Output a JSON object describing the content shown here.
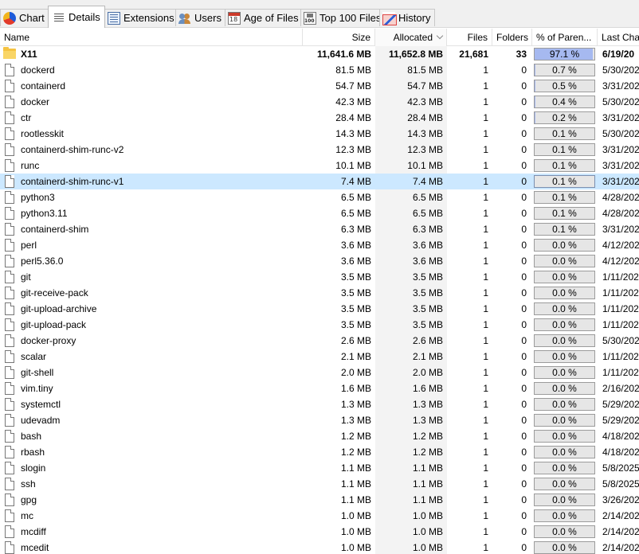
{
  "tabs": [
    {
      "label": "Chart",
      "icon": "chart-icon"
    },
    {
      "label": "Details",
      "icon": "details-icon",
      "active": true
    },
    {
      "label": "Extensions",
      "icon": "extensions-icon"
    },
    {
      "label": "Users",
      "icon": "users-icon"
    },
    {
      "label": "Age of Files",
      "icon": "calendar-icon"
    },
    {
      "label": "Top 100 Files",
      "icon": "top100-icon"
    },
    {
      "label": "History",
      "icon": "history-icon"
    }
  ],
  "columns": {
    "name": "Name",
    "size": "Size",
    "allocated": "Allocated",
    "files": "Files",
    "folders": "Folders",
    "percent": "% of Paren...",
    "last_change": "Last Char"
  },
  "rows": [
    {
      "name": "X11",
      "type": "folder",
      "size": "11,641.6 MB",
      "allocated": "11,652.8 MB",
      "files": "21,681",
      "folders": "33",
      "percent": "97.1 %",
      "percent_value": 97.1,
      "date": "6/19/20"
    },
    {
      "name": "dockerd",
      "type": "file",
      "size": "81.5 MB",
      "allocated": "81.5 MB",
      "files": "1",
      "folders": "0",
      "percent": "0.7 %",
      "percent_value": 0.7,
      "date": "5/30/202"
    },
    {
      "name": "containerd",
      "type": "file",
      "size": "54.7 MB",
      "allocated": "54.7 MB",
      "files": "1",
      "folders": "0",
      "percent": "0.5 %",
      "percent_value": 0.5,
      "date": "3/31/202"
    },
    {
      "name": "docker",
      "type": "file",
      "size": "42.3 MB",
      "allocated": "42.3 MB",
      "files": "1",
      "folders": "0",
      "percent": "0.4 %",
      "percent_value": 0.4,
      "date": "5/30/202"
    },
    {
      "name": "ctr",
      "type": "file",
      "size": "28.4 MB",
      "allocated": "28.4 MB",
      "files": "1",
      "folders": "0",
      "percent": "0.2 %",
      "percent_value": 0.2,
      "date": "3/31/202"
    },
    {
      "name": "rootlesskit",
      "type": "file",
      "size": "14.3 MB",
      "allocated": "14.3 MB",
      "files": "1",
      "folders": "0",
      "percent": "0.1 %",
      "percent_value": 0.1,
      "date": "5/30/202"
    },
    {
      "name": "containerd-shim-runc-v2",
      "type": "file",
      "size": "12.3 MB",
      "allocated": "12.3 MB",
      "files": "1",
      "folders": "0",
      "percent": "0.1 %",
      "percent_value": 0.1,
      "date": "3/31/202"
    },
    {
      "name": "runc",
      "type": "file",
      "size": "10.1 MB",
      "allocated": "10.1 MB",
      "files": "1",
      "folders": "0",
      "percent": "0.1 %",
      "percent_value": 0.1,
      "date": "3/31/202"
    },
    {
      "name": "containerd-shim-runc-v1",
      "type": "file",
      "size": "7.4 MB",
      "allocated": "7.4 MB",
      "files": "1",
      "folders": "0",
      "percent": "0.1 %",
      "percent_value": 0.1,
      "date": "3/31/202",
      "selected": true
    },
    {
      "name": "python3",
      "type": "file",
      "size": "6.5 MB",
      "allocated": "6.5 MB",
      "files": "1",
      "folders": "0",
      "percent": "0.1 %",
      "percent_value": 0.1,
      "date": "4/28/202"
    },
    {
      "name": "python3.11",
      "type": "file",
      "size": "6.5 MB",
      "allocated": "6.5 MB",
      "files": "1",
      "folders": "0",
      "percent": "0.1 %",
      "percent_value": 0.1,
      "date": "4/28/202"
    },
    {
      "name": "containerd-shim",
      "type": "file",
      "size": "6.3 MB",
      "allocated": "6.3 MB",
      "files": "1",
      "folders": "0",
      "percent": "0.1 %",
      "percent_value": 0.1,
      "date": "3/31/202"
    },
    {
      "name": "perl",
      "type": "file",
      "size": "3.6 MB",
      "allocated": "3.6 MB",
      "files": "1",
      "folders": "0",
      "percent": "0.0 %",
      "percent_value": 0.0,
      "date": "4/12/202"
    },
    {
      "name": "perl5.36.0",
      "type": "file",
      "size": "3.6 MB",
      "allocated": "3.6 MB",
      "files": "1",
      "folders": "0",
      "percent": "0.0 %",
      "percent_value": 0.0,
      "date": "4/12/202"
    },
    {
      "name": "git",
      "type": "file",
      "size": "3.5 MB",
      "allocated": "3.5 MB",
      "files": "1",
      "folders": "0",
      "percent": "0.0 %",
      "percent_value": 0.0,
      "date": "1/11/202"
    },
    {
      "name": "git-receive-pack",
      "type": "file",
      "size": "3.5 MB",
      "allocated": "3.5 MB",
      "files": "1",
      "folders": "0",
      "percent": "0.0 %",
      "percent_value": 0.0,
      "date": "1/11/202"
    },
    {
      "name": "git-upload-archive",
      "type": "file",
      "size": "3.5 MB",
      "allocated": "3.5 MB",
      "files": "1",
      "folders": "0",
      "percent": "0.0 %",
      "percent_value": 0.0,
      "date": "1/11/202"
    },
    {
      "name": "git-upload-pack",
      "type": "file",
      "size": "3.5 MB",
      "allocated": "3.5 MB",
      "files": "1",
      "folders": "0",
      "percent": "0.0 %",
      "percent_value": 0.0,
      "date": "1/11/202"
    },
    {
      "name": "docker-proxy",
      "type": "file",
      "size": "2.6 MB",
      "allocated": "2.6 MB",
      "files": "1",
      "folders": "0",
      "percent": "0.0 %",
      "percent_value": 0.0,
      "date": "5/30/202"
    },
    {
      "name": "scalar",
      "type": "file",
      "size": "2.1 MB",
      "allocated": "2.1 MB",
      "files": "1",
      "folders": "0",
      "percent": "0.0 %",
      "percent_value": 0.0,
      "date": "1/11/202"
    },
    {
      "name": "git-shell",
      "type": "file",
      "size": "2.0 MB",
      "allocated": "2.0 MB",
      "files": "1",
      "folders": "0",
      "percent": "0.0 %",
      "percent_value": 0.0,
      "date": "1/11/202"
    },
    {
      "name": "vim.tiny",
      "type": "file",
      "size": "1.6 MB",
      "allocated": "1.6 MB",
      "files": "1",
      "folders": "0",
      "percent": "0.0 %",
      "percent_value": 0.0,
      "date": "2/16/202"
    },
    {
      "name": "systemctl",
      "type": "file",
      "size": "1.3 MB",
      "allocated": "1.3 MB",
      "files": "1",
      "folders": "0",
      "percent": "0.0 %",
      "percent_value": 0.0,
      "date": "5/29/202"
    },
    {
      "name": "udevadm",
      "type": "file",
      "size": "1.3 MB",
      "allocated": "1.3 MB",
      "files": "1",
      "folders": "0",
      "percent": "0.0 %",
      "percent_value": 0.0,
      "date": "5/29/202"
    },
    {
      "name": "bash",
      "type": "file",
      "size": "1.2 MB",
      "allocated": "1.2 MB",
      "files": "1",
      "folders": "0",
      "percent": "0.0 %",
      "percent_value": 0.0,
      "date": "4/18/202"
    },
    {
      "name": "rbash",
      "type": "file",
      "size": "1.2 MB",
      "allocated": "1.2 MB",
      "files": "1",
      "folders": "0",
      "percent": "0.0 %",
      "percent_value": 0.0,
      "date": "4/18/202"
    },
    {
      "name": "slogin",
      "type": "file",
      "size": "1.1 MB",
      "allocated": "1.1 MB",
      "files": "1",
      "folders": "0",
      "percent": "0.0 %",
      "percent_value": 0.0,
      "date": "5/8/2025"
    },
    {
      "name": "ssh",
      "type": "file",
      "size": "1.1 MB",
      "allocated": "1.1 MB",
      "files": "1",
      "folders": "0",
      "percent": "0.0 %",
      "percent_value": 0.0,
      "date": "5/8/2025"
    },
    {
      "name": "gpg",
      "type": "file",
      "size": "1.1 MB",
      "allocated": "1.1 MB",
      "files": "1",
      "folders": "0",
      "percent": "0.0 %",
      "percent_value": 0.0,
      "date": "3/26/202"
    },
    {
      "name": "mc",
      "type": "file",
      "size": "1.0 MB",
      "allocated": "1.0 MB",
      "files": "1",
      "folders": "0",
      "percent": "0.0 %",
      "percent_value": 0.0,
      "date": "2/14/202"
    },
    {
      "name": "mcdiff",
      "type": "file",
      "size": "1.0 MB",
      "allocated": "1.0 MB",
      "files": "1",
      "folders": "0",
      "percent": "0.0 %",
      "percent_value": 0.0,
      "date": "2/14/202"
    },
    {
      "name": "mcedit",
      "type": "file",
      "size": "1.0 MB",
      "allocated": "1.0 MB",
      "files": "1",
      "folders": "0",
      "percent": "0.0 %",
      "percent_value": 0.0,
      "date": "2/14/202"
    }
  ]
}
